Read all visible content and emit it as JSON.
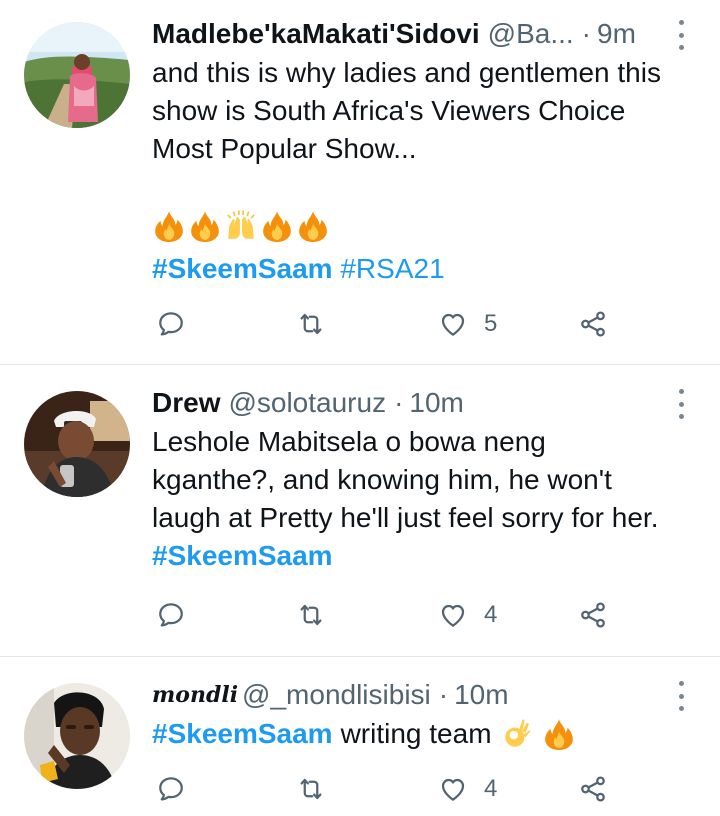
{
  "tweets": [
    {
      "name": "Madlebe'kaMakati'Sidovi",
      "handle": "@Ba...",
      "separator": "·",
      "time": "9m",
      "text_lines": [
        "and this is why ladies and gentlemen this",
        "show is South Africa's Viewers Choice",
        "Most Popular Show..."
      ],
      "emojis": [
        "fire-emoji",
        "fire-emoji",
        "raising-hands-emoji",
        "fire-emoji",
        "fire-emoji"
      ],
      "hashtags": [
        "#SkeemSaam",
        "#RSA21"
      ],
      "likes": "5"
    },
    {
      "name": "Drew",
      "handle": "@solotauruz",
      "separator": "·",
      "time": "10m",
      "text_lines": [
        "Leshole Mabitsela o bowa neng",
        "kganthe?, and knowing him, he won't",
        "laugh at Pretty he'll just feel sorry for her."
      ],
      "hashtag": "#SkeemSaam",
      "likes": "4"
    },
    {
      "name": "mondli",
      "handle": "@_mondlisibisi",
      "separator": "·",
      "time": "10m",
      "hashtag": "#SkeemSaam",
      "text": "writing team",
      "emojis": [
        "ok-hand-emoji",
        "fire-emoji"
      ],
      "likes": "4"
    }
  ],
  "colors": {
    "accent": "#1d9bf0",
    "secondary_text": "#536471",
    "primary_text": "#0f1419",
    "divider": "#e1e6ea",
    "icon": "#536471"
  },
  "icons": [
    "reply-icon",
    "retweet-icon",
    "like-icon",
    "share-icon",
    "more-icon"
  ]
}
